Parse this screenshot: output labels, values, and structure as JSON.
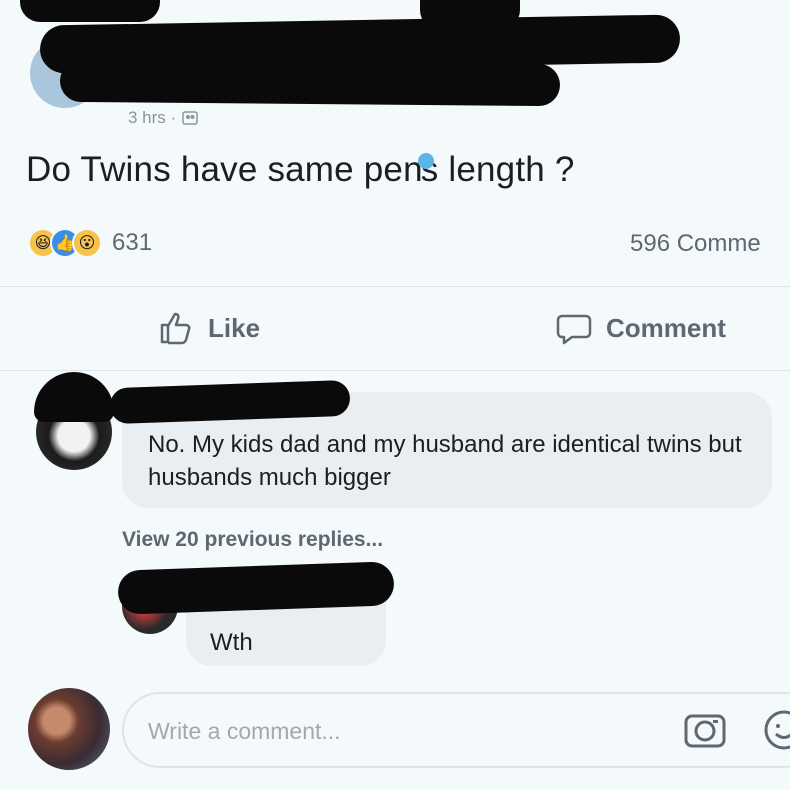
{
  "post": {
    "meta_time": "3 hrs ·",
    "text_before": "Do Twins have same pen",
    "text_after": "s length ?",
    "reaction_count": "631",
    "comment_count": "596 Comme"
  },
  "actions": {
    "like_label": "Like",
    "comment_label": "Comment"
  },
  "comments": [
    {
      "text": "No. My kids dad and my husband are identical twins but husbands much bigger"
    },
    {
      "text": "Wth"
    }
  ],
  "view_replies": "View 20 previous replies...",
  "composer": {
    "placeholder": "Write a comment..."
  },
  "icons": {
    "reactions": [
      "haha-reaction-icon",
      "like-reaction-icon",
      "wow-reaction-icon"
    ],
    "like": "thumbs-up-icon",
    "comment": "speech-bubble-icon",
    "camera": "camera-icon",
    "emoji": "emoji-icon",
    "privacy": "friends-icon"
  },
  "colors": {
    "background": "#f4fafc",
    "muted_text": "#606770",
    "bubble": "#e8eef2",
    "redaction": "#0a0a0a"
  }
}
